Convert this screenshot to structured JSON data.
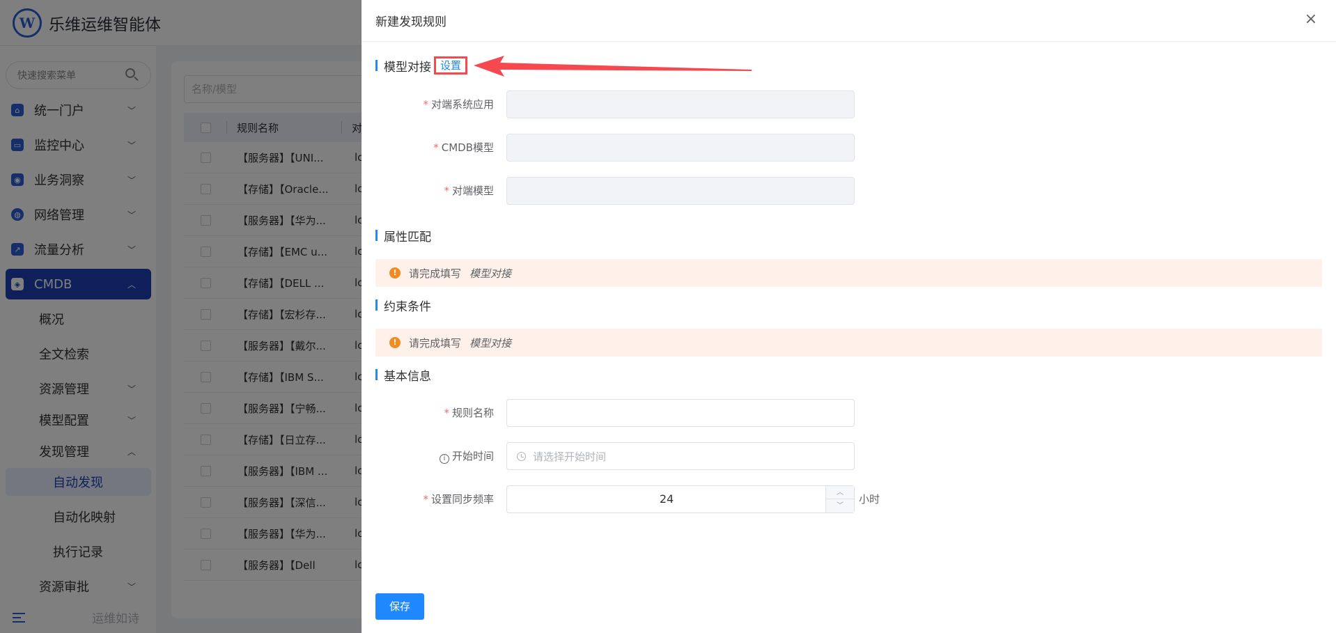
{
  "app": {
    "title": "乐维运维智能体",
    "logo_letter": "W"
  },
  "sidebar": {
    "search_placeholder": "快速搜索菜单",
    "items": [
      {
        "label": "统一门户",
        "icon": "home-icon"
      },
      {
        "label": "监控中心",
        "icon": "monitor-icon"
      },
      {
        "label": "业务洞察",
        "icon": "insight-icon"
      },
      {
        "label": "网络管理",
        "icon": "globe-icon"
      },
      {
        "label": "流量分析",
        "icon": "chart-icon"
      },
      {
        "label": "CMDB",
        "icon": "cube-icon"
      }
    ],
    "sub_items": [
      "概况",
      "全文检索",
      "资源管理",
      "模型配置",
      "发现管理",
      "自动发现",
      "自动化映射",
      "执行记录",
      "资源审批"
    ],
    "footer_text": "运维如诗"
  },
  "background_table": {
    "filter_placeholder": "名称/模型",
    "header_name": "规则名称",
    "header_col2": "对",
    "rows": [
      "【服务器】【UNI...",
      "【存储】【Oracle...",
      "【服务器】【华为...",
      "【存储】【EMC u...",
      "【存储】【DELL ...",
      "【存储】【宏杉存...",
      "【服务器】【戴尔...",
      "【存储】【IBM S...",
      "【服务器】【宁畅...",
      "【存储】【日立存...",
      "【服务器】【IBM ...",
      "【服务器】【深信...",
      "【服务器】【华为...",
      "【服务器】【Dell"
    ],
    "col2_value": "lc"
  },
  "drawer": {
    "title": "新建发现规则",
    "sections": {
      "model": {
        "title": "模型对接",
        "setting_link": "设置"
      },
      "attr": {
        "title": "属性匹配"
      },
      "constraint": {
        "title": "约束条件"
      },
      "basic": {
        "title": "基本信息"
      }
    },
    "fields": {
      "peer_app": {
        "label": "对端系统应用",
        "required_mark": "*"
      },
      "cmdb_model": {
        "label": "CMDB模型",
        "required_mark": "*"
      },
      "peer_model": {
        "label": "对端模型",
        "required_mark": "*"
      },
      "rule_name": {
        "label": "规则名称",
        "required_mark": "*",
        "value": ""
      },
      "start_time": {
        "label": "开始时间",
        "info_mark": "i",
        "placeholder": "请选择开始时间"
      },
      "sync_freq": {
        "label": "设置同步频率",
        "required_mark": "*",
        "value": "24",
        "unit": "小时",
        "up": "︿",
        "down": "﹀"
      }
    },
    "warning": {
      "text": "请完成填写",
      "emphasis": "模型对接",
      "icon_glyph": "!"
    },
    "save_label": "保存",
    "close_glyph": "×"
  },
  "colors": {
    "primary": "#1f88ff",
    "brand": "#2c5fd6",
    "annotation_red": "#f5484f",
    "warning": "#f08c22"
  }
}
